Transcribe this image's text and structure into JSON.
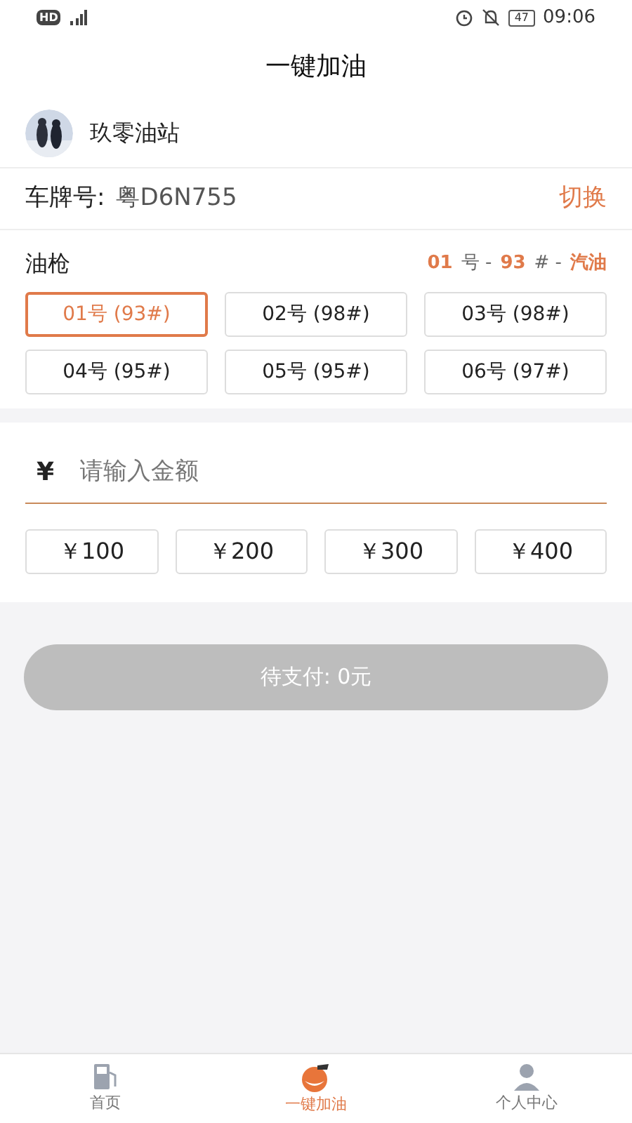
{
  "status_bar": {
    "network_badge": "HD",
    "battery": "47",
    "time": "09:06"
  },
  "title": "一键加油",
  "station": {
    "name": "玖零油站"
  },
  "plate": {
    "label": "车牌号:",
    "value": "粤D6N755",
    "action": "切换"
  },
  "nozzles": {
    "label": "油枪",
    "summary": {
      "nozzle": "01",
      "nozzle_suffix": "号 -",
      "grade": "93",
      "grade_suffix": "# -",
      "fuel": "汽油"
    },
    "items": [
      {
        "label": "01号 (93#)",
        "selected": true
      },
      {
        "label": "02号 (98#)",
        "selected": false
      },
      {
        "label": "03号 (98#)",
        "selected": false
      },
      {
        "label": "04号 (95#)",
        "selected": false
      },
      {
        "label": "05号 (95#)",
        "selected": false
      },
      {
        "label": "06号 (97#)",
        "selected": false
      }
    ]
  },
  "amount": {
    "currency": "¥",
    "placeholder": "请输入金额",
    "presets": [
      "￥100",
      "￥200",
      "￥300",
      "￥400"
    ]
  },
  "pay_button": {
    "label": "待支付: 0元",
    "disabled": true
  },
  "tab_bar": [
    {
      "label": "首页",
      "kind": "pump",
      "selected": false
    },
    {
      "label": "一键加油",
      "kind": "fruit",
      "selected": true
    },
    {
      "label": "个人中心",
      "kind": "person",
      "selected": false
    }
  ]
}
